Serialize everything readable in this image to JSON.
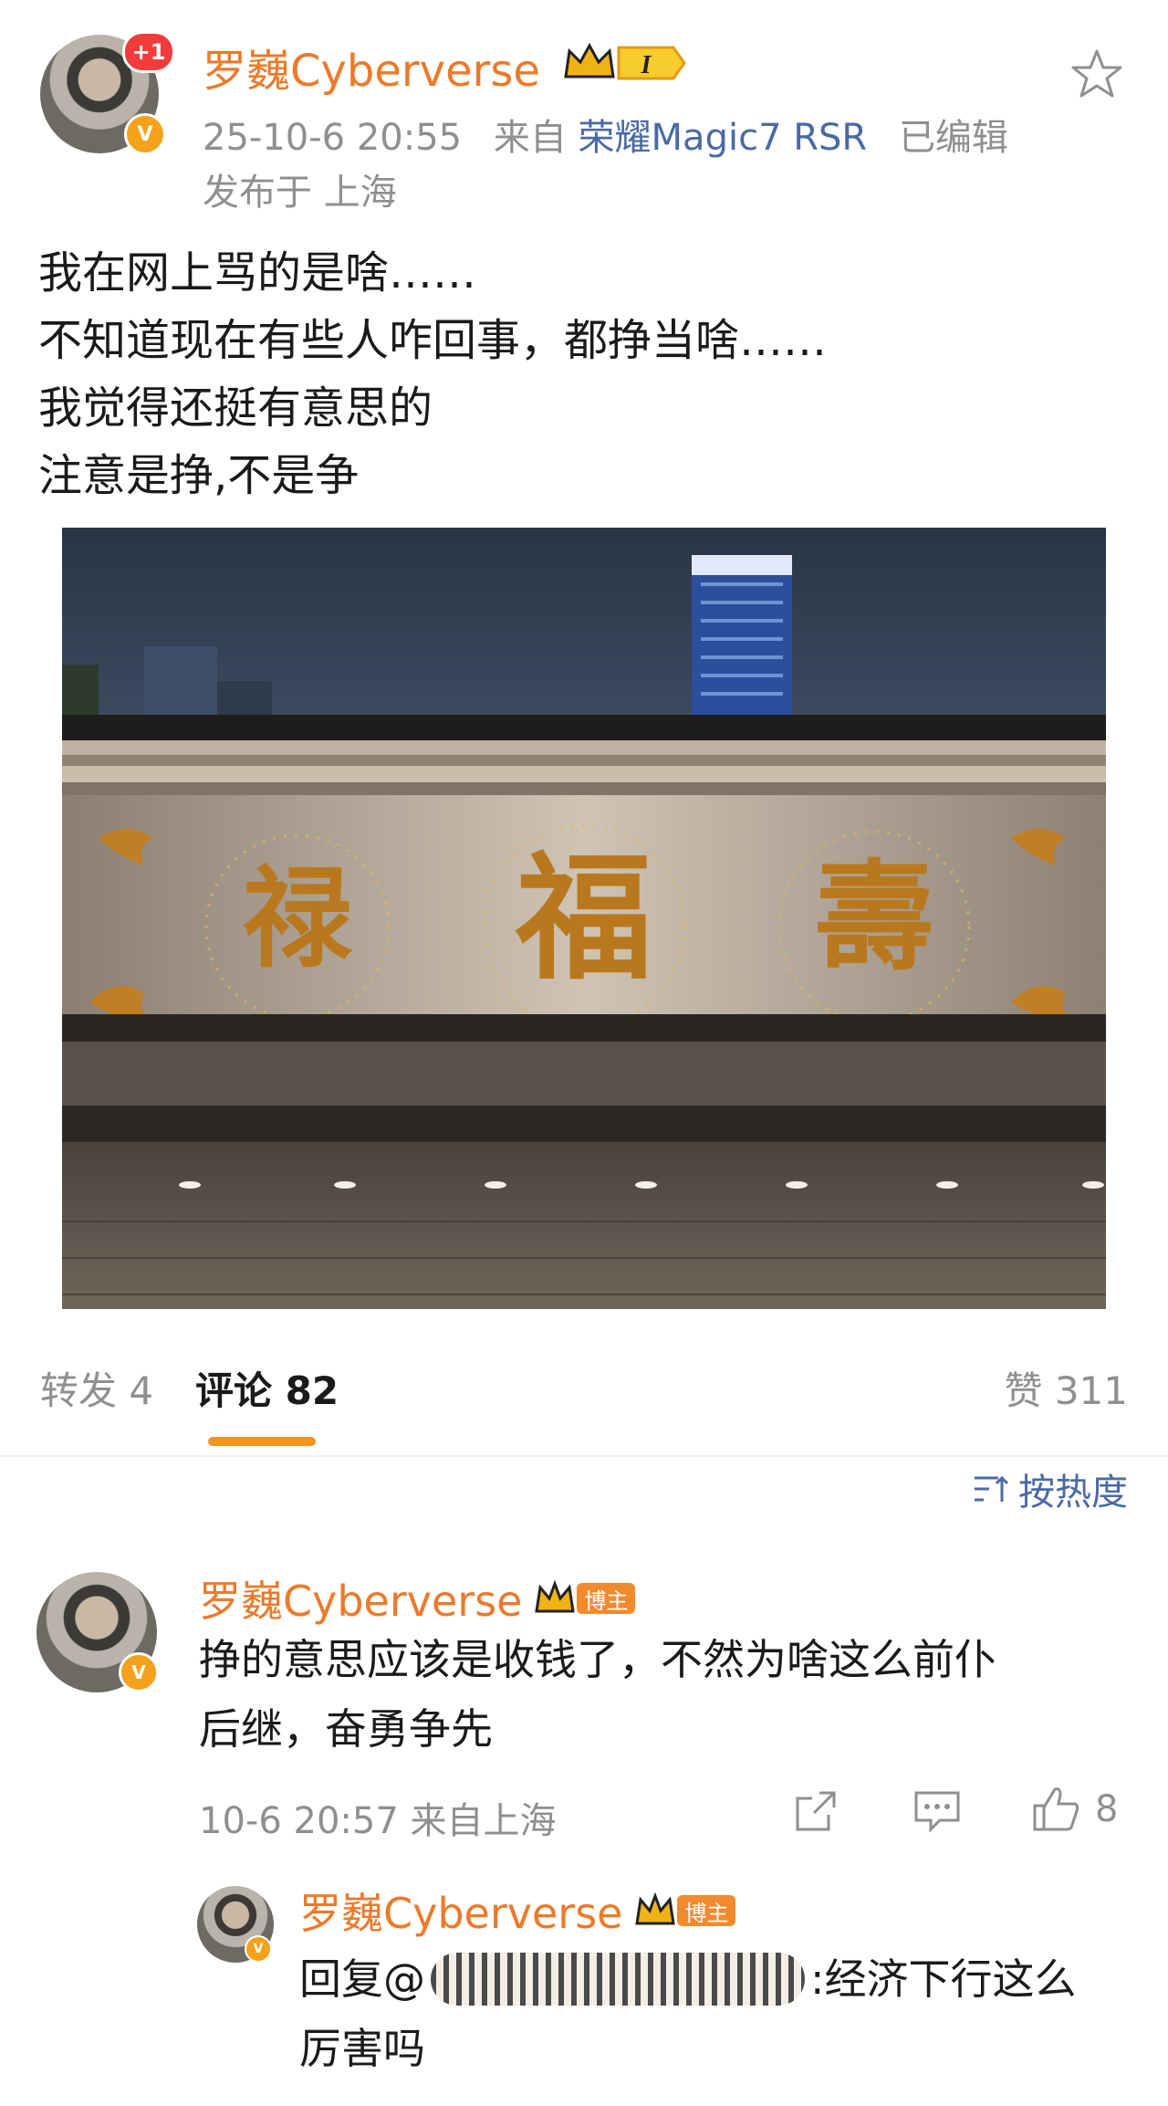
{
  "post": {
    "author": "罗巍Cyberverse",
    "notification_count": "+1",
    "verified_mark": "V",
    "level_badge": "I",
    "time": "25-10-6 20:55",
    "from_label": "来自",
    "device": "荣耀Magic7 RSR",
    "edited": "已编辑",
    "location": "发布于 上海",
    "text_lines": [
      "我在网上骂的是啥……",
      "不知道现在有些人咋回事，都挣当啥……",
      "我觉得还挺有意思的",
      "注意是挣,不是争"
    ],
    "image_chars": {
      "left": "禄",
      "center": "福",
      "right": "壽"
    }
  },
  "tabs": {
    "repost": "转发 4",
    "comments": "评论 82",
    "likes": "赞 311"
  },
  "sort": {
    "icon": "sort-icon",
    "label": "按热度"
  },
  "comment": {
    "author": "罗巍Cyberverse",
    "host_badge": "博主",
    "text_lines": [
      "挣的意思应该是收钱了，不然为啥这么前仆",
      "后继，奋勇争先"
    ],
    "time": "10-6 20:57 来自上海",
    "like_count": "8"
  },
  "reply": {
    "author": "罗巍Cyberverse",
    "host_badge": "博主",
    "text_prefix": "回复@",
    "text_suffix": ":经济下行这么",
    "text_line2": "厉害吗"
  },
  "colors": {
    "brand": "#eb7a2a",
    "link": "#4a6aa5",
    "tab_indicator": "#f29422"
  }
}
